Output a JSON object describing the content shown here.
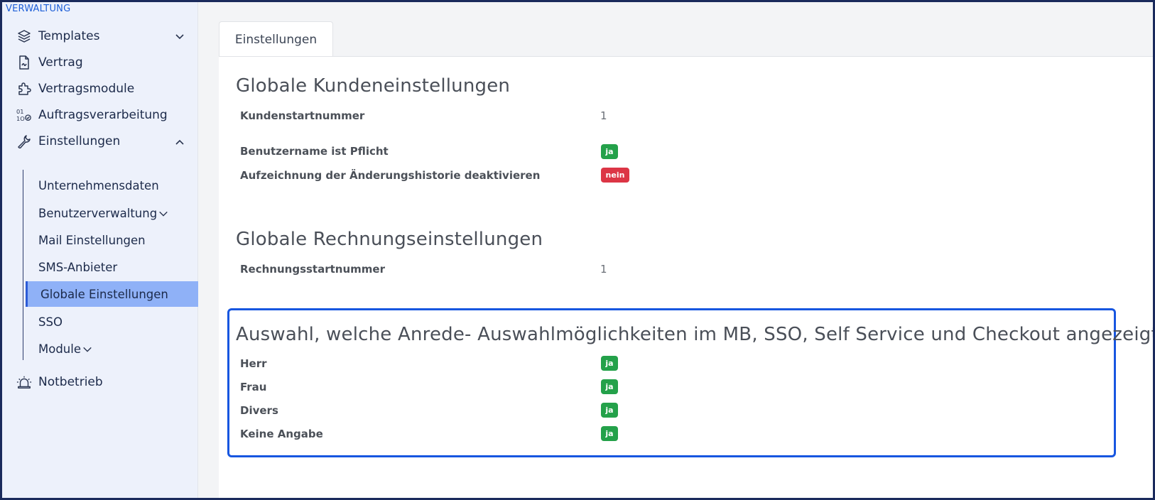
{
  "sidebar": {
    "section_label": "VERWALTUNG",
    "items": [
      {
        "label": "Templates",
        "icon": "layers-icon",
        "chevron": "down"
      },
      {
        "label": "Vertrag",
        "icon": "document-icon"
      },
      {
        "label": "Vertragsmodule",
        "icon": "puzzle-icon"
      },
      {
        "label": "Auftragsverarbeitung",
        "icon": "binary-check-icon"
      },
      {
        "label": "Einstellungen",
        "icon": "wrench-icon",
        "chevron": "up"
      },
      {
        "label": "Notbetrieb",
        "icon": "siren-icon"
      }
    ],
    "subitems": [
      {
        "label": "Unternehmensdaten"
      },
      {
        "label": "Benutzerverwaltung"
      },
      {
        "label": "Mail Einstellungen"
      },
      {
        "label": "SMS-Anbieter"
      },
      {
        "label": "Globale Einstellungen",
        "active": true
      },
      {
        "label": "SSO"
      },
      {
        "label": "Module"
      }
    ]
  },
  "main": {
    "tab_label": "Einstellungen",
    "sections": [
      {
        "title": "Globale Kundeneinstellungen",
        "rows": [
          {
            "label": "Kundenstartnummer",
            "value": "1"
          },
          {
            "label": "Benutzername ist Pflicht",
            "badge": "ja"
          },
          {
            "label": "Aufzeichnung der Änderungshistorie deaktivieren",
            "badge": "nein"
          }
        ]
      },
      {
        "title": "Globale Rechnungseinstellungen",
        "rows": [
          {
            "label": "Rechnungsstartnummer",
            "value": "1"
          }
        ]
      },
      {
        "title": "Auswahl, welche Anrede- Auswahlmöglichkeiten im MB, SSO, Self Service und Checkout angezeigt werden.",
        "rows": [
          {
            "label": "Herr",
            "badge": "ja"
          },
          {
            "label": "Frau",
            "badge": "ja"
          },
          {
            "label": "Divers",
            "badge": "ja"
          },
          {
            "label": "Keine Angabe",
            "badge": "ja"
          }
        ]
      }
    ]
  },
  "colors": {
    "accent": "#1756e0",
    "active_bg": "#8fb1f7",
    "badge_yes": "#24a14a",
    "badge_no": "#dc3545",
    "sidebar_bg": "#edf1fb"
  }
}
